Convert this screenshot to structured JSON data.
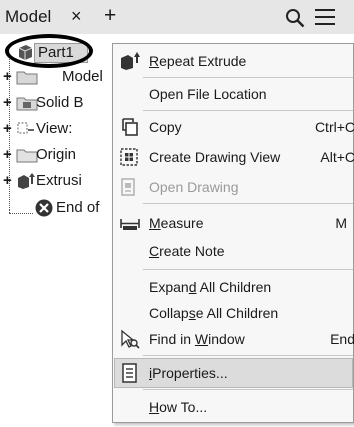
{
  "tab": {
    "label": "Model",
    "close_glyph": "×",
    "add_glyph": "+"
  },
  "toolbar": {
    "search_icon": "search-icon",
    "menu_icon": "hamburger-icon"
  },
  "tree": {
    "items": [
      {
        "label": "Part1",
        "icon": "part-icon",
        "selected": true
      },
      {
        "label": "Model",
        "icon": "folder-icon"
      },
      {
        "label": "Solid B",
        "icon": "solid-bodies-icon"
      },
      {
        "label": "View:",
        "icon": "view-icon"
      },
      {
        "label": "Origin",
        "icon": "folder-icon"
      },
      {
        "label": "Extrusi",
        "icon": "extrusion-icon"
      },
      {
        "label": "End of",
        "icon": "end-of-part-icon"
      }
    ],
    "expander": "+"
  },
  "menu": {
    "items": [
      {
        "id": "repeat-extrude",
        "label": "Repeat Extrude",
        "mnemonic": "R",
        "shortcut": "",
        "icon": "extrude-icon"
      },
      {
        "id": "open-file-location",
        "label": "Open File Location",
        "mnemonic": "",
        "shortcut": ""
      },
      {
        "id": "copy",
        "label": "Copy",
        "mnemonic": "",
        "shortcut": "Ctrl+C",
        "icon": "copy-icon"
      },
      {
        "id": "create-drawing-view",
        "label": "Create Drawing View",
        "mnemonic": "",
        "shortcut": "Alt+C",
        "icon": "drawing-view-icon"
      },
      {
        "id": "open-drawing",
        "label": "Open Drawing",
        "mnemonic": "",
        "shortcut": "",
        "icon": "open-drawing-icon",
        "disabled": true
      },
      {
        "id": "measure",
        "label": "Measure",
        "mnemonic": "M",
        "shortcut": "M",
        "icon": "measure-icon"
      },
      {
        "id": "create-note",
        "label": "Create Note",
        "mnemonic": "C",
        "shortcut": ""
      },
      {
        "id": "expand-all-children",
        "label": "Expand All Children",
        "mnemonic": "d",
        "shortcut": ""
      },
      {
        "id": "collapse-all-children",
        "label": "Collapse All Children",
        "mnemonic": "s",
        "shortcut": ""
      },
      {
        "id": "find-in-window",
        "label": "Find in Window",
        "mnemonic": "W",
        "shortcut": "End",
        "icon": "find-icon"
      },
      {
        "id": "iproperties",
        "label": "iProperties...",
        "mnemonic": "i",
        "shortcut": "",
        "icon": "iproperties-icon",
        "hovered": true
      },
      {
        "id": "how-to",
        "label": "How To...",
        "mnemonic": "H",
        "shortcut": ""
      }
    ]
  }
}
